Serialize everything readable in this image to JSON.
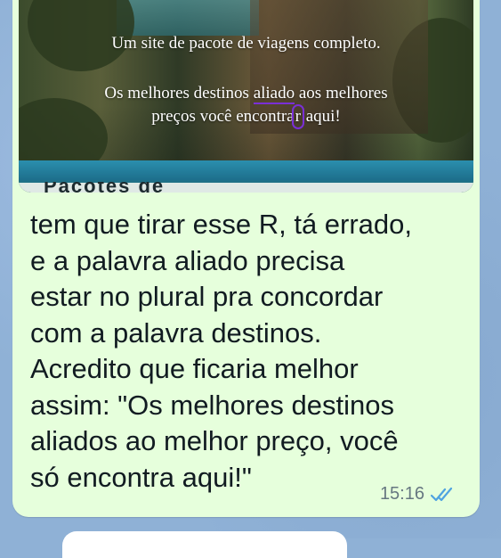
{
  "image_caption": {
    "line1": "Um site de pacote de viagens completo.",
    "line2_pre": "Os melhores destinos ",
    "line2_marked": "aliado",
    "line2_post": " aos melhores",
    "line3_pre": "preços você encontra",
    "line3_marked": "r",
    "line3_post": " aqui!",
    "bottom_cut_text": "Pacotes de"
  },
  "message": {
    "lines": [
      "tem que tirar esse R, tá errado,",
      "e a palavra aliado precisa",
      "estar no plural pra concordar",
      "com a palavra destinos.",
      "Acredito que ficaria melhor",
      "assim: \"Os melhores destinos",
      "aliados ao melhor preço, você",
      "só encontra aqui!\""
    ],
    "time": "15:16",
    "status_icon": "double-check-read-icon",
    "tick_color": "#4fa3e0"
  },
  "colors": {
    "bubble": "#e6ffdc",
    "chat_background": "#8fb1d6",
    "annotation": "#7a2fd6"
  }
}
